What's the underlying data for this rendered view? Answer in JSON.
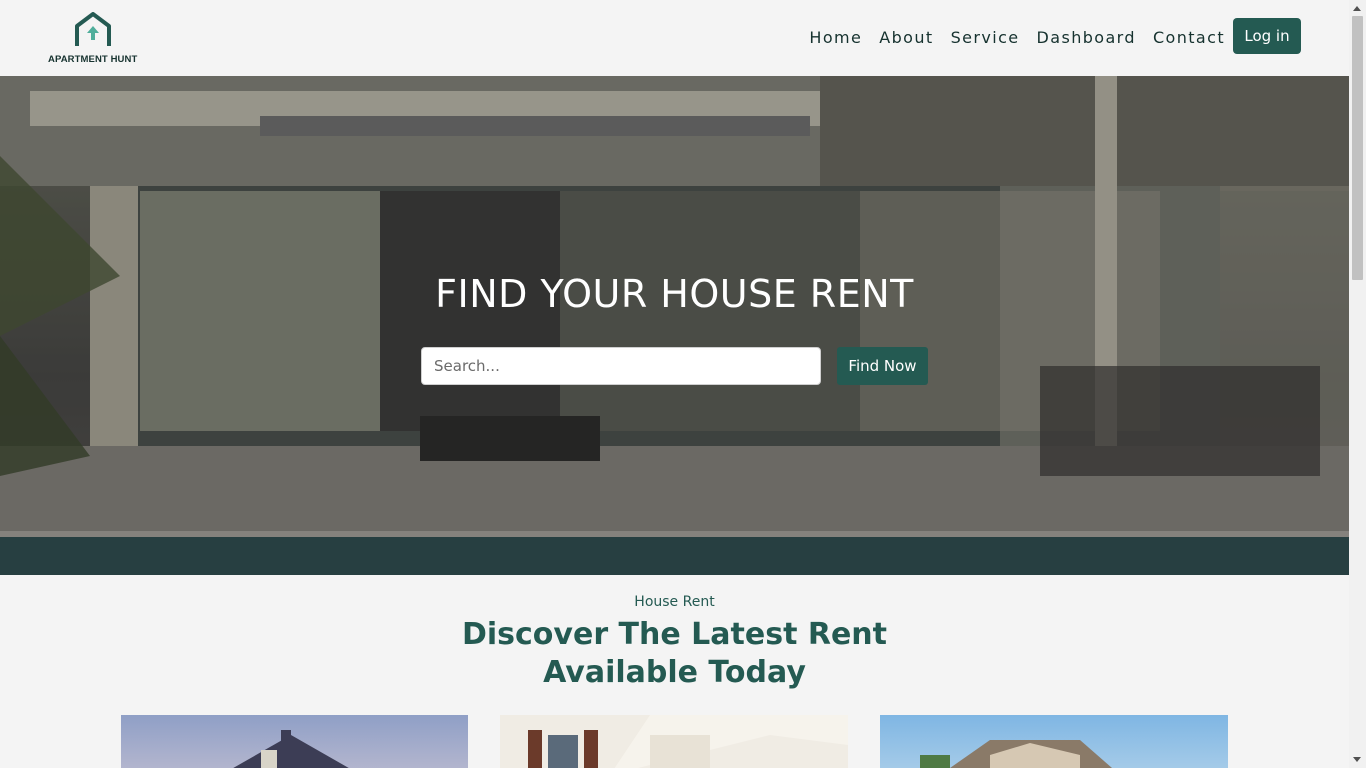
{
  "brand": {
    "logo_text": "APARTMENT HUNT",
    "accent": "#245a52",
    "dark": "#16322f"
  },
  "nav": {
    "items": [
      "Home",
      "About",
      "Service",
      "Dashboard",
      "Contact"
    ],
    "login_label": "Log in"
  },
  "hero": {
    "title": "FIND YOUR HOUSE RENT",
    "search_placeholder": "Search...",
    "search_value": "",
    "find_button": "Find Now"
  },
  "section": {
    "eyebrow": "House Rent",
    "title_line1": "Discover The Latest Rent",
    "title_line2": "Available Today"
  },
  "icons": {
    "logo": "house-logo-icon"
  }
}
